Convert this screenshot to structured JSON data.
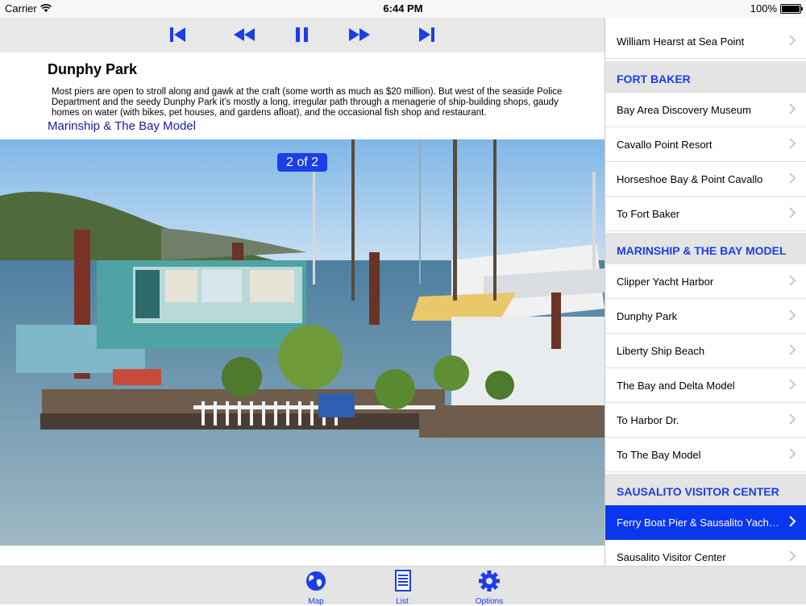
{
  "status": {
    "carrier": "Carrier",
    "time": "6:44 PM",
    "battery": "100%"
  },
  "toolbar": {
    "buttons": [
      "skip-back",
      "rewind",
      "pause",
      "fast-forward",
      "skip-forward"
    ],
    "accent": "#1b3ee6"
  },
  "detail": {
    "title": "Dunphy Park",
    "description": "Most piers are open to stroll along and gawk at the craft (some worth as much as $20 million). But west of the seaside Police Department and the seedy Dunphy Park it’s mostly a long, irregular path through a menagerie of ship-building shops, gaudy homes on water (with bikes, pet houses, and gardens afloat), and the occasional fish shop and restaurant.",
    "link": "Marinship & The Bay Model",
    "pager": "2 of 2"
  },
  "list": {
    "top_item": "William Hearst at Sea Point",
    "sections": [
      {
        "title": "FORT BAKER",
        "items": [
          "Bay Area Discovery Museum",
          "Cavallo Point Resort",
          "Horseshoe Bay & Point Cavallo",
          "To Fort Baker"
        ]
      },
      {
        "title": "MARINSHIP & THE BAY MODEL",
        "items": [
          "Clipper Yacht Harbor",
          "Dunphy Park",
          "Liberty Ship Beach",
          "The Bay and Delta Model",
          "To Harbor Dr.",
          "To The Bay Model"
        ]
      },
      {
        "title": "SAUSALITO VISITOR CENTER",
        "items": [
          "Ferry Boat Pier & Sausalito Yach…",
          "Sausalito Visitor Center"
        ]
      }
    ],
    "selected": "Ferry Boat Pier & Sausalito Yach…"
  },
  "tabs": [
    {
      "label": "Map",
      "icon": "globe-icon"
    },
    {
      "label": "List",
      "icon": "document-icon"
    },
    {
      "label": "Options",
      "icon": "gear-icon"
    }
  ]
}
